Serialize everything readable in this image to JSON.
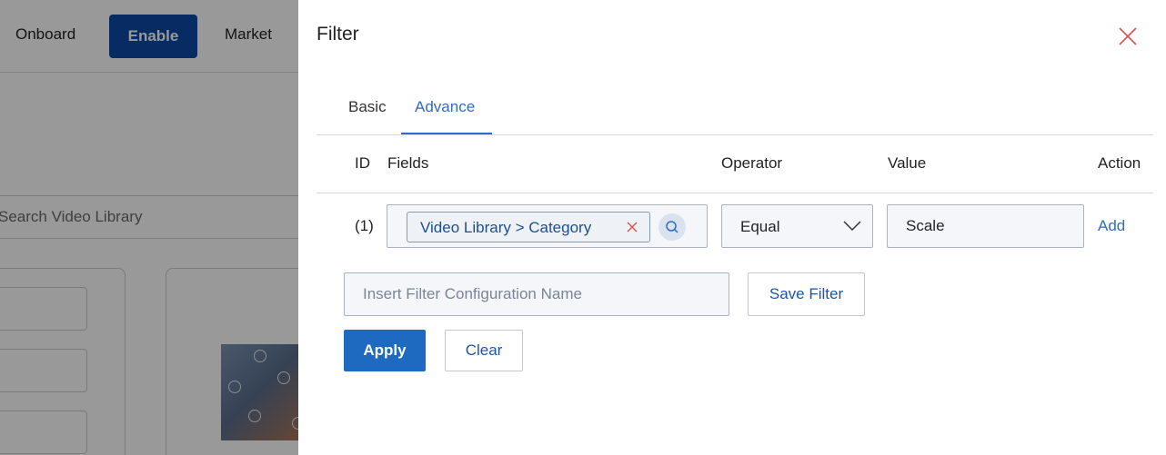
{
  "background": {
    "nav": {
      "onboard": "Onboard",
      "enable": "Enable",
      "market": "Market"
    },
    "search_text": "Search Video Library"
  },
  "drawer": {
    "title": "Filter",
    "close_icon": "close-icon",
    "tabs": [
      {
        "label": "Basic",
        "active": false
      },
      {
        "label": "Advance",
        "active": true
      }
    ],
    "columns": {
      "id": "ID",
      "fields": "Fields",
      "operator": "Operator",
      "value": "Value",
      "action": "Action"
    },
    "rows": [
      {
        "id": "(1)",
        "field_chip": "Video Library > Category",
        "operator": "Equal",
        "value": "Scale",
        "action": "Add"
      }
    ],
    "config_name": {
      "value": "",
      "placeholder": "Insert Filter Configuration Name"
    },
    "save_filter_label": "Save Filter",
    "apply_label": "Apply",
    "clear_label": "Clear"
  },
  "colors": {
    "accent": "#2f6bc7",
    "primary_button": "#1f6ac1",
    "close_icon": "#d9534f",
    "nav_enable": "#0b4aa6"
  }
}
